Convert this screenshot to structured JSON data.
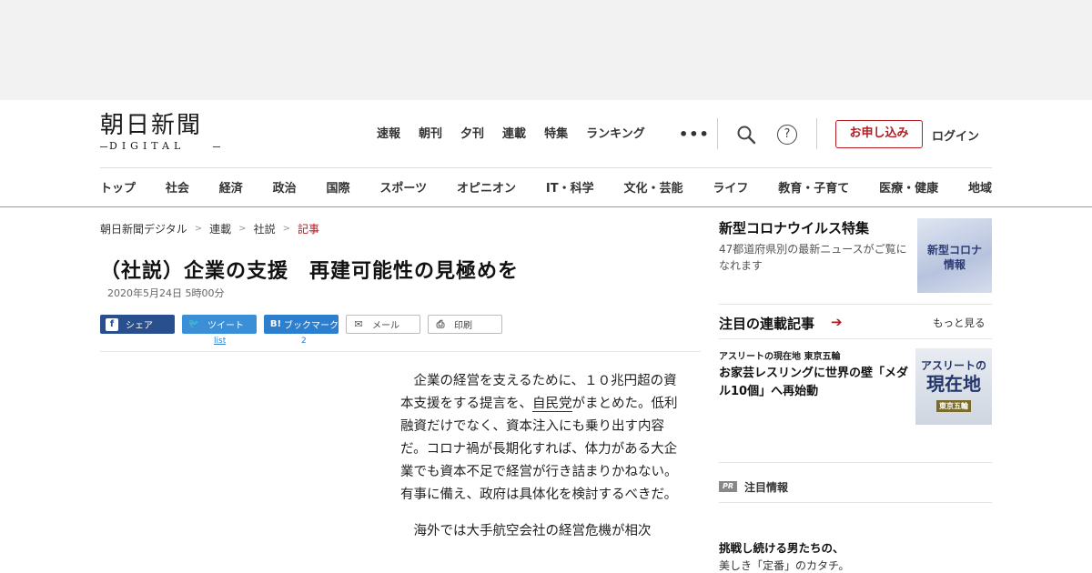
{
  "logo": {
    "main": "朝日新聞",
    "sub": "DIGITAL"
  },
  "topnav": [
    "速報",
    "朝刊",
    "夕刊",
    "連載",
    "特集",
    "ランキング"
  ],
  "header": {
    "more": "•••",
    "help": "?",
    "apply_label": "お申し込み",
    "login_label": "ログイン"
  },
  "catnav": [
    "トップ",
    "社会",
    "経済",
    "政治",
    "国際",
    "スポーツ",
    "オピニオン",
    "IT・科学",
    "文化・芸能",
    "ライフ",
    "教育・子育て",
    "医療・健康",
    "地域"
  ],
  "breadcrumb": [
    "朝日新聞デジタル",
    "連載",
    "社説",
    "記事"
  ],
  "article": {
    "headline": "（社説）企業の支援　再建可能性の見極めを",
    "date": "2020年5月24日 5時00分",
    "p1_a": "企業の経営を支えるために、１０兆円超の資本支援をする提言を、",
    "p1_kw": "自民党",
    "p1_b": "がまとめた。低利融資だけでなく、資本注入にも乗り出す内容だ。コロナ禍が長期化すれば、体力がある大企業でも資本不足で経営が行き詰まりかねない。有事に備え、政府は具体化を検討するべきだ。",
    "p2": "海外では大手航空会社の経営危機が相次"
  },
  "share": {
    "facebook": "シェア",
    "twitter": "ツイート",
    "twitter_count": "list",
    "hatena_icon": "B!",
    "hatena": "ブックマーク",
    "hatena_count": "2",
    "mail": "メール",
    "print": "印刷"
  },
  "sidebar": {
    "feature_title": "新型コロナウイルス特集",
    "feature_desc": "47都道府県別の最新ニュースがご覧になれます",
    "feature_thumb_line1": "新型コロナ",
    "feature_thumb_line2": "情報",
    "series_title": "注目の連載記事",
    "series_more": "もっと見る",
    "series_kicker": "アスリートの現在地 東京五輪",
    "series_headline": "お家芸レスリングに世界の壁「メダル10個」へ再始動",
    "series_thumb_line1": "アスリートの",
    "series_thumb_line2": "現在地",
    "series_thumb_line3": "東京五輪",
    "pr_badge": "PR",
    "pr_title": "注目情報",
    "promo_headline": "挑戦し続ける男たちの、",
    "promo_sub": "美しき「定番」のカタチ。"
  },
  "colors": {
    "accent_red": "#b21c23",
    "facebook": "#2a4f8f",
    "twitter": "#3b8fd6",
    "hatena": "#2c7fcf"
  }
}
